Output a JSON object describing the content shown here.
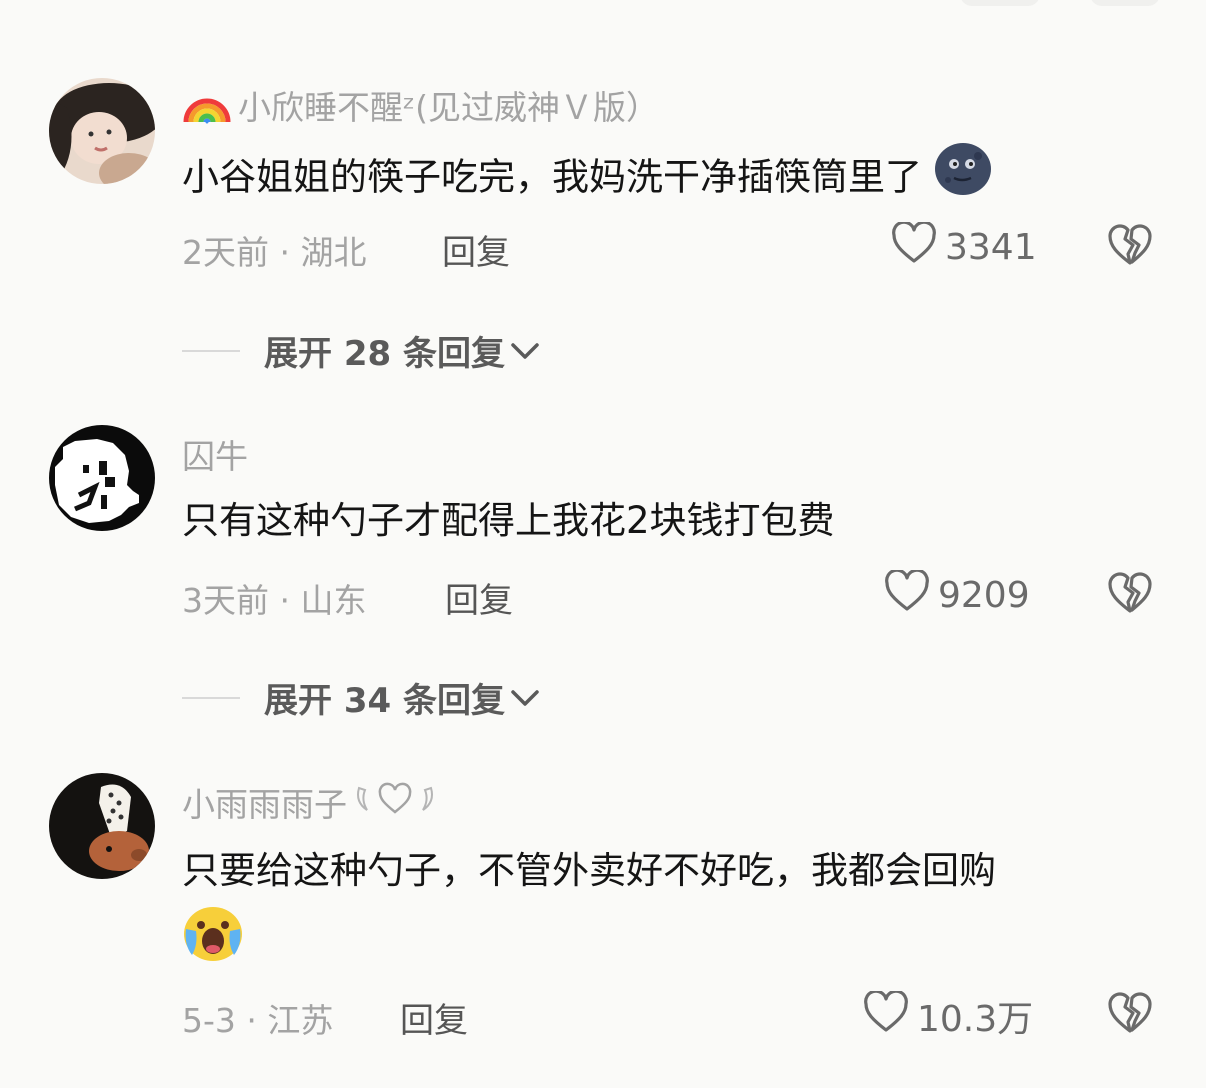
{
  "comments": [
    {
      "username": "小欣睡不醒ᶻ(见过威神Ｖ版）",
      "text": "小谷姐姐的筷子吃完，我妈洗干净插筷筒里了",
      "time_location": "2天前 · 湖北",
      "reply_label": "回复",
      "likes": "3341",
      "expand_label": "展开 28 条回复",
      "username_icon": "rainbow-icon",
      "trailing_emoji": "new-moon-face-icon"
    },
    {
      "username": "囚牛",
      "text": "只有这种勺子才配得上我花2块钱打包费",
      "time_location": "3天前 · 山东",
      "reply_label": "回复",
      "likes": "9209",
      "expand_label": "展开 34 条回复"
    },
    {
      "username": "小雨雨雨子",
      "text": "只要给这种勺子，不管外卖好不好吃，我都会回购",
      "time_location": "5-3 · 江苏",
      "reply_label": "回复",
      "likes": "10.3万",
      "username_icon": "winged-heart-icon",
      "trailing_emoji": "crying-face-icon"
    }
  ],
  "colors": {
    "background": "#fafaf8",
    "username": "#a3a3a3",
    "text": "#151515",
    "meta": "#a3a3a3",
    "expand": "#5a5a5a"
  }
}
